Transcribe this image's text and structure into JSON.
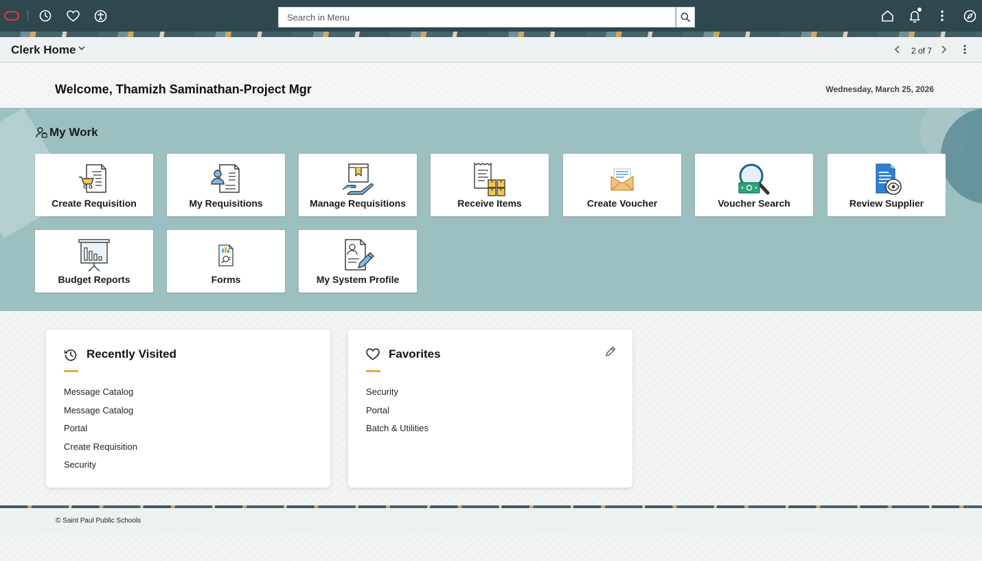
{
  "topbar": {
    "search_placeholder": "Search in Menu",
    "icons": [
      "oracle-logo",
      "history-icon",
      "heart-icon",
      "accessibility-icon",
      "search-icon",
      "home-icon",
      "bell-icon",
      "kebab-icon",
      "compass-icon"
    ]
  },
  "subheader": {
    "title": "Clerk Home",
    "pager": "2 of 7"
  },
  "welcome": {
    "greeting": "Welcome, Thamizh Saminathan-Project Mgr",
    "date": "Wednesday, March 25, 2026"
  },
  "mywork": {
    "title": "My Work",
    "tiles": [
      {
        "label": "Create Requisition"
      },
      {
        "label": "My Requisitions"
      },
      {
        "label": "Manage Requisitions"
      },
      {
        "label": "Receive Items"
      },
      {
        "label": "Create Voucher"
      },
      {
        "label": "Voucher Search"
      },
      {
        "label": "Review Supplier"
      },
      {
        "label": "Budget Reports"
      },
      {
        "label": "Forms"
      },
      {
        "label": "My System Profile"
      }
    ]
  },
  "recent": {
    "title": "Recently Visited",
    "items": [
      "Message Catalog",
      "Message Catalog",
      "Portal",
      "Create Requisition",
      "Security"
    ]
  },
  "favorites": {
    "title": "Favorites",
    "items": [
      "Security",
      "Portal",
      "Batch & Utilities"
    ]
  },
  "footer": {
    "copyright": "© Saint Paul Public Schools"
  },
  "colors": {
    "topbar": "#2f474f",
    "mywork_band": "#9cbfbf",
    "accent": "#e9a83f",
    "oracle_red": "#e0392b"
  }
}
